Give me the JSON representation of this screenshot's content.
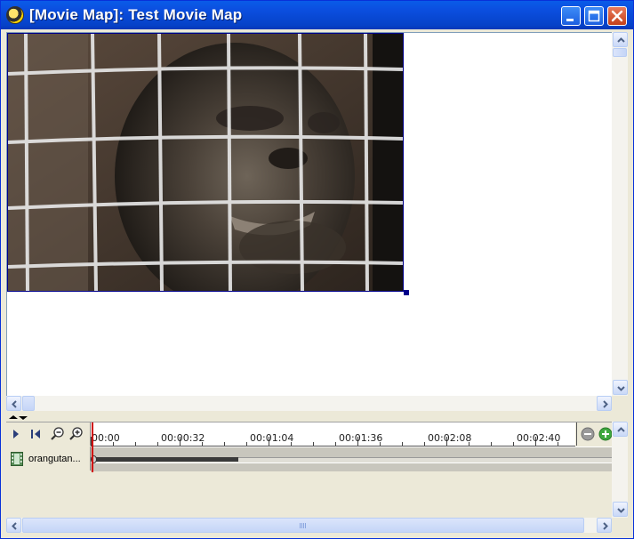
{
  "window": {
    "title": "[Movie Map]: Test Movie Map"
  },
  "timeline": {
    "ruler_labels": [
      "00:00",
      "00:00:32",
      "00:01:04",
      "00:01:36",
      "00:02:08",
      "00:02:40"
    ],
    "tracks": [
      {
        "name": "orangutan..."
      }
    ],
    "clip_fraction": 0.28,
    "playhead_time": "00:00"
  },
  "colors": {
    "titlebar": "#0a5ce8",
    "selection_border": "#00008b",
    "playhead": "#d00000",
    "close_button": "#c4401a"
  },
  "icons": {
    "app": "movie-map-icon",
    "minimize": "minimize-icon",
    "maximize": "maximize-icon",
    "close": "close-icon",
    "play": "play-icon",
    "rewind": "go-to-start-icon",
    "zoom_out": "zoom-out-icon",
    "zoom_in": "zoom-in-icon",
    "remove": "remove-icon",
    "add": "add-icon",
    "film": "film-strip-icon"
  }
}
